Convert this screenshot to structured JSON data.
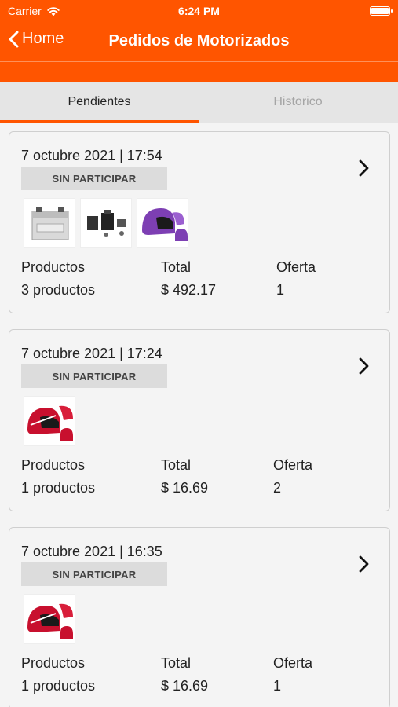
{
  "status_bar": {
    "carrier": "Carrier",
    "time": "6:24 PM"
  },
  "nav": {
    "back_label": "Home",
    "title": "Pedidos de Motorizados"
  },
  "tabs": [
    {
      "label": "Pendientes",
      "active": true
    },
    {
      "label": "Historico",
      "active": false
    }
  ],
  "colors": {
    "accent": "#ff5500",
    "tab_bg": "#e5e5e5",
    "badge_bg": "#dcdcdc"
  },
  "orders": [
    {
      "date": "7 octubre 2021 | 17:54",
      "status": "SIN PARTICIPAR",
      "thumbnails": [
        "battery-image",
        "motor-parts-image",
        "purple-helmet-image"
      ],
      "products_label": "Productos",
      "products_value": "3 productos",
      "total_label": "Total",
      "total_value": "$ 492.17",
      "offer_label": "Oferta",
      "offer_value": "1"
    },
    {
      "date": "7 octubre 2021 | 17:24",
      "status": "SIN PARTICIPAR",
      "thumbnails": [
        "red-helmet-image"
      ],
      "products_label": "Productos",
      "products_value": "1 productos",
      "total_label": "Total",
      "total_value": "$ 16.69",
      "offer_label": "Oferta",
      "offer_value": "2"
    },
    {
      "date": "7 octubre 2021 | 16:35",
      "status": "SIN PARTICIPAR",
      "thumbnails": [
        "red-helmet-image"
      ],
      "products_label": "Productos",
      "products_value": "1 productos",
      "total_label": "Total",
      "total_value": "$ 16.69",
      "offer_label": "Oferta",
      "offer_value": "1"
    }
  ]
}
